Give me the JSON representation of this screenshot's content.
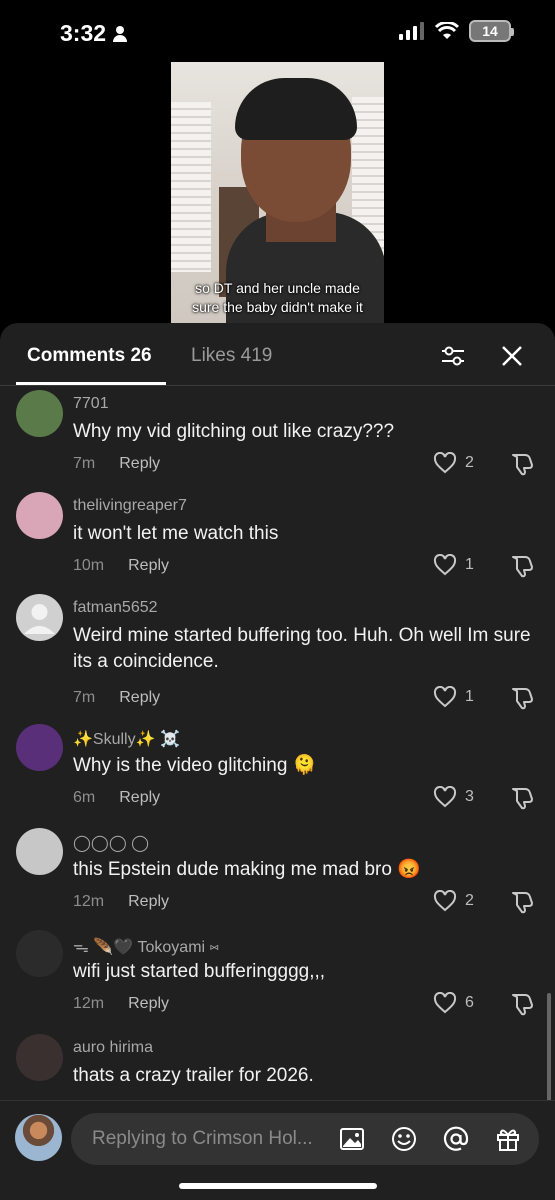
{
  "status_bar": {
    "time": "3:32",
    "battery": "14"
  },
  "video": {
    "caption_line1": "so DT and her uncle made",
    "caption_line2": "sure the baby didn't make it"
  },
  "tabs": {
    "comments": "Comments 26",
    "likes": "Likes 419"
  },
  "comments": [
    {
      "username": "7701",
      "text": "Why my vid glitching out like crazy???",
      "time": "7m",
      "reply": "Reply",
      "likes": "2",
      "avatar_color": "#5b7a4a"
    },
    {
      "username": "thelivingreaper7",
      "text": "it won't let me watch this",
      "time": "10m",
      "reply": "Reply",
      "likes": "1",
      "avatar_color": "#d9a6b8"
    },
    {
      "username": "fatman5652",
      "text": "Weird mine started buffering too. Huh. Oh well Im sure its a coincidence.",
      "time": "7m",
      "reply": "Reply",
      "likes": "1",
      "avatar_color": "#d0d0d0"
    },
    {
      "username": "✨Skully✨ ☠️",
      "text": "Why is the video glitching 🫠",
      "time": "6m",
      "reply": "Reply",
      "likes": "3",
      "avatar_color": "#5a2f7a"
    },
    {
      "username": "◯◯◯ ◯",
      "text": "this Epstein dude making me mad bro 😡",
      "time": "12m",
      "reply": "Reply",
      "likes": "2",
      "avatar_color": "#c7c7c7"
    },
    {
      "username": "ᯓ 🪶🖤 Tokoyami ⑅",
      "text": "wifi just started bufferingggg,,,",
      "time": "12m",
      "reply": "Reply",
      "likes": "6",
      "avatar_color": "#2b2b2b"
    },
    {
      "username": "auro hirima",
      "text": "thats a crazy trailer for 2026.",
      "time": "",
      "reply": "",
      "likes": "",
      "avatar_color": "#3a3030"
    }
  ],
  "input": {
    "placeholder": "Replying to Crimson Hol..."
  }
}
